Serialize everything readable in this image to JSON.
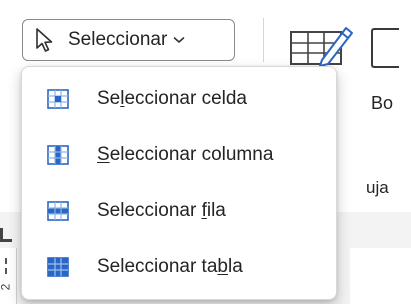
{
  "ribbon": {
    "select_button": {
      "label": "Seleccionar",
      "icons": {
        "leading": "cursor-arrow-icon",
        "trailing": "chevron-down-icon"
      }
    },
    "draw_table_icon": "draw-table-pencil-icon",
    "side_label_top": "Bo",
    "side_label_bottom": "uja"
  },
  "ruler": {
    "number": "2"
  },
  "menu": {
    "items": [
      {
        "pre": "Se",
        "u": "l",
        "post": "eccionar celda",
        "icon": "table-select-cell-icon"
      },
      {
        "pre": "",
        "u": "S",
        "post": "eleccionar columna",
        "icon": "table-select-column-icon"
      },
      {
        "pre": "Seleccionar ",
        "u": "f",
        "post": "ila",
        "icon": "table-select-row-icon"
      },
      {
        "pre": "Seleccionar ta",
        "u": "b",
        "post": "la",
        "icon": "table-select-table-icon"
      }
    ]
  },
  "colors": {
    "accent": "#2b66c4",
    "accent_light": "#9dbff0",
    "grid_line": "#8fb3e6"
  }
}
